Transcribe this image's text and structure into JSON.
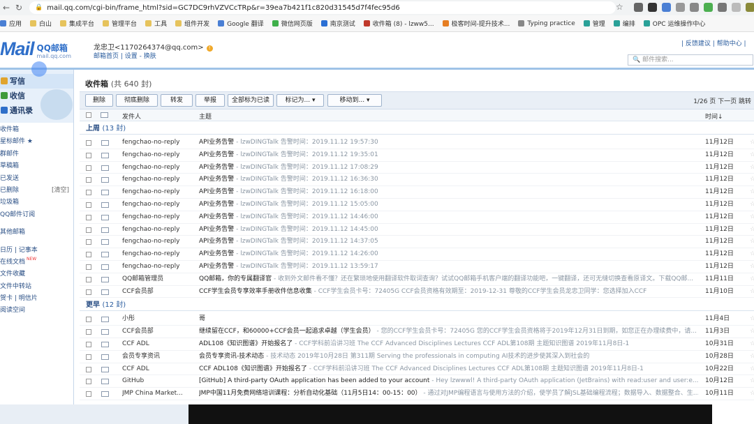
{
  "browser": {
    "url": "mail.qq.com/cgi-bin/frame_html?sid=GC7DC9rhVZVCcTRp&r=39ea7b421f1c820d31545d7f4fec95d6"
  },
  "bookmarks": [
    "应用",
    "白山",
    "集成平台",
    "管理平台",
    "工具",
    "组件开发",
    "Google 翻译",
    "微信网页版",
    "南京测试",
    "收件箱 (8) - lzww5...",
    "极客时间-提升技术...",
    "Typing practice",
    "管理",
    "编排",
    "OPC 运维操作中心"
  ],
  "header": {
    "logo_text": "Mail",
    "logo_cn": "QQ邮箱",
    "logo_domain": "mail.qq.com",
    "user": "龙忠卫<1170264374@qq.com>",
    "links": "邮箱首页 | 设置 - 换肤",
    "right_links": "| 反馈建议 | 帮助中心 |",
    "search_placeholder": "邮件搜索..."
  },
  "sidebar": {
    "write": "写信",
    "receive": "收信",
    "contacts": "通讯录",
    "items": [
      "收件箱",
      "星标邮件 ★",
      "群邮件",
      "草稿箱",
      "已发送",
      "已删除",
      "垃圾箱",
      "QQ邮件订阅"
    ],
    "clear_label": "[清空]",
    "items2": [
      "其他邮箱"
    ],
    "items3": [
      "日历 | 记事本",
      "在线文档",
      "文件收藏",
      "文件中转站",
      "贺卡 | 明信片",
      "阅读空间"
    ],
    "new_badge": "NEW"
  },
  "main": {
    "title": "收件箱",
    "count": "(共 640 封)",
    "toolbar": [
      "删除",
      "彻底删除",
      "转发",
      "举报",
      "全部标为已读",
      "标记为... ▾",
      "移动到... ▾"
    ],
    "pagination": "1/26 页 下一页 跳转",
    "columns": {
      "sender": "发件人",
      "subject": "主题",
      "time": "时间↓"
    },
    "groups": [
      {
        "label": "上周",
        "count": "(13 封)",
        "rows": [
          {
            "sender": "fengchao-no-reply",
            "subject": "API业务告警",
            "preview": " - lzwDINGTalk 告警时间：2019.11.12 19:57:30",
            "date": "11月12日"
          },
          {
            "sender": "fengchao-no-reply",
            "subject": "API业务告警",
            "preview": " - lzwDINGTalk 告警时间：2019.11.12 19:35:01",
            "date": "11月12日"
          },
          {
            "sender": "fengchao-no-reply",
            "subject": "API业务告警",
            "preview": " - lzwDINGTalk 告警时间：2019.11.12 17:08:29",
            "date": "11月12日"
          },
          {
            "sender": "fengchao-no-reply",
            "subject": "API业务告警",
            "preview": " - lzwDINGTalk 告警时间：2019.11.12 16:36:30",
            "date": "11月12日"
          },
          {
            "sender": "fengchao-no-reply",
            "subject": "API业务告警",
            "preview": " - lzwDINGTalk 告警时间：2019.11.12 16:18:00",
            "date": "11月12日"
          },
          {
            "sender": "fengchao-no-reply",
            "subject": "API业务告警",
            "preview": " - lzwDINGTalk 告警时间：2019.11.12 15:05:00",
            "date": "11月12日"
          },
          {
            "sender": "fengchao-no-reply",
            "subject": "API业务告警",
            "preview": " - lzwDINGTalk 告警时间：2019.11.12 14:46:00",
            "date": "11月12日"
          },
          {
            "sender": "fengchao-no-reply",
            "subject": "API业务告警",
            "preview": " - lzwDINGTalk 告警时间：2019.11.12 14:45:00",
            "date": "11月12日"
          },
          {
            "sender": "fengchao-no-reply",
            "subject": "API业务告警",
            "preview": " - lzwDINGTalk 告警时间：2019.11.12 14:37:05",
            "date": "11月12日"
          },
          {
            "sender": "fengchao-no-reply",
            "subject": "API业务告警",
            "preview": " - lzwDINGTalk 告警时间：2019.11.12 14:26:00",
            "date": "11月12日"
          },
          {
            "sender": "fengchao-no-reply",
            "subject": "API业务告警",
            "preview": " - lzwDINGTalk 告警时间：2019.11.12 13:59:17",
            "date": "11月12日"
          },
          {
            "sender": "QQ邮箱管理员",
            "subject": "QQ邮箱，你的专属翻译官",
            "preview": " - 收到外文邮件看不懂？还在繁琐地使用翻译软件取词查询？试试QQ邮箱手机客户端的翻译功能吧，一键翻译，还可无缝切换查看原译文。下载QQ邮...",
            "date": "11月11日"
          },
          {
            "sender": "CCF会员部",
            "subject": "CCF学生会员专享效率手册收件信息收集",
            "preview": " - CCF学生会员卡号：72405G CCF会员资格有效期至：2019-12-31 尊敬的CCF学生会员龙忠卫同学：您选择加入CCF",
            "date": "11月10日"
          }
        ]
      },
      {
        "label": "更早",
        "count": "(12 封)",
        "rows": [
          {
            "sender": "小彤",
            "subject": "哥",
            "preview": "",
            "date": "11月4日"
          },
          {
            "sender": "CCF会员部",
            "subject": "继续留在CCF，和60000+CCF会员一起追求卓越（学生会员）",
            "preview": " - 您的CCF学生会员卡号：72405G 您的CCF学生会员资格将于2019年12月31日到期，如您正在办理续费中，请...",
            "date": "11月3日"
          },
          {
            "sender": "CCF ADL",
            "subject": "ADL108《知识图谱》开始报名了",
            "preview": " - CCF学科前沿讲习班 The CCF Advanced Disciplines Lectures CCF ADL第108期 主题知识图谱 2019年11月8日-1",
            "date": "10月31日"
          },
          {
            "sender": "会员专享资讯",
            "subject": "会员专享资讯-技术动态",
            "preview": " - 技术动态 2019年10月28日 第311期 Serving the professionals in computing AI技术的进步使其深入到社会的",
            "date": "10月28日"
          },
          {
            "sender": "CCF ADL",
            "subject": "CCF ADL108《知识图谱》开始报名了",
            "preview": " - CCF学科前沿讲习班 The CCF Advanced Disciplines Lectures CCF ADL第108期 主题知识图谱 2019年11月8日-1",
            "date": "10月22日"
          },
          {
            "sender": "GitHub",
            "subject": "[GitHub] A third-party OAuth application has been added to your account",
            "preview": " - Hey lzwwwl! A third-party OAuth application (JetBrains) with read:user and user:e...",
            "date": "10月12日"
          },
          {
            "sender": "JMP China Market...",
            "subject": "JMP中国11月免费网络培训课程：分析自动化基础（11月5日14：00-15：00）",
            "preview": " - 通过对JMP编程语言与使用方法的介绍，使学员了解JSL基础编程流程；数据导入、数据整合、生...",
            "date": "10月11日"
          }
        ]
      }
    ]
  }
}
